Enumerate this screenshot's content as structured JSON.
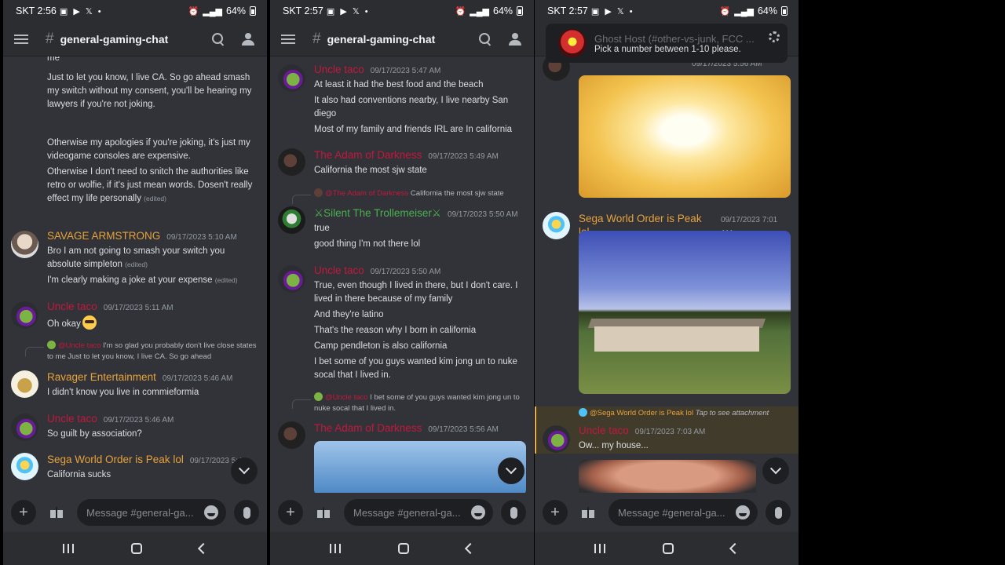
{
  "status": {
    "phone1_time": "SKT 2:56",
    "phone2_time": "SKT 2:57",
    "phone3_time": "SKT 2:57",
    "left_icons": "▣ ▶ 𝕏 •",
    "battery": "64%"
  },
  "header": {
    "hash": "#",
    "channel": "general-gaming-chat"
  },
  "composer": {
    "placeholder": "Message #general-ga..."
  },
  "colors": {
    "uncle": "#c3183d",
    "orange": "#e8a23b",
    "green": "#4caf50",
    "sega": "#e8a23b"
  },
  "phone1": {
    "cont_lines": [
      "me",
      "Just to let you know, I live CA. So go ahead smash my switch without my consent, you'll be hearing my lawyers if you're not joking.",
      "Otherwise my apologies if you're joking, it's just my videogame consoles are expensive.",
      "Otherwise I don't need to snitch the authorities like retro or wolfie, if it's just mean words. Dosen't really effect my life personally"
    ],
    "edited": "(edited)",
    "savage": {
      "author": "SAVAGE ARMSTRONG",
      "ts": "09/17/2023 5:10 AM",
      "l1": "Bro I am not going to smash your switch you absolute simpleton",
      "l2": "I'm clearly making a joke at your expense"
    },
    "uncle1": {
      "author": "Uncle taco",
      "ts": "09/17/2023 5:11 AM",
      "text": "Oh okay"
    },
    "reply": {
      "author": "@Uncle taco",
      "text": "I'm so glad you probably don't live close states to me  Just to let you know, I live CA. So go ahead"
    },
    "ravager": {
      "author": "Ravager Entertainment",
      "ts": "09/17/2023 5:46 AM",
      "text": "I didn't know you live in commieformia"
    },
    "uncle2": {
      "author": "Uncle taco",
      "ts": "09/17/2023 5:46 AM",
      "text": "So guilt by association?"
    },
    "sega": {
      "author": "Sega World Order is Peak lol",
      "ts": "09/17/2023 5:4",
      "text": "California sucks"
    }
  },
  "phone2": {
    "uncle1": {
      "author": "Uncle taco",
      "ts": "09/17/2023 5:47 AM",
      "lines": [
        "At least it had the best food and the beach",
        "It also had conventions nearby, I live nearby San diego",
        "Most of my family and friends IRL are In california"
      ]
    },
    "adam1": {
      "author": "The Adam of Darkness",
      "ts": "09/17/2023 5:49 AM",
      "text": "California the most sjw state"
    },
    "reply1": {
      "author": "@The Adam of Darkness",
      "text": "California the most sjw state"
    },
    "silent": {
      "author": "⚔Silent The Trollemeiser⚔",
      "ts": "09/17/2023 5:50 AM",
      "l1": "true",
      "l2": "good thing I'm not there lol"
    },
    "uncle2": {
      "author": "Uncle taco",
      "ts": "09/17/2023 5:50 AM",
      "lines": [
        "True, even though I lived in there, but I don't care. I lived in there because of my family",
        "And they're latino",
        "That's the reason why I born in california",
        "Camp pendleton is also california",
        "I bet some of you guys wanted kim jong un to nuke socal that I lived in."
      ]
    },
    "reply2": {
      "author": "@Uncle taco",
      "text": "I bet some of you guys wanted kim jong un to nuke socal that I lived in."
    },
    "adam2": {
      "author": "The Adam of Darkness",
      "ts": "09/17/2023 5:56 AM"
    }
  },
  "phone3": {
    "toast": {
      "title": "Ghost Host (#other-vs-junk, FCC ...",
      "text": "Pick a number between 1-10 please."
    },
    "partial_ts": "09/17/2023 5:56 AM",
    "sega": {
      "author": "Sega World Order is Peak lol",
      "ts": "09/17/2023 7:01 AM"
    },
    "reply": {
      "author": "@Sega World Order is Peak lol",
      "text": "Tap to see attachment"
    },
    "uncle": {
      "author": "Uncle taco",
      "ts": "09/17/2023 7:03 AM",
      "text": "Ow... my house..."
    }
  }
}
